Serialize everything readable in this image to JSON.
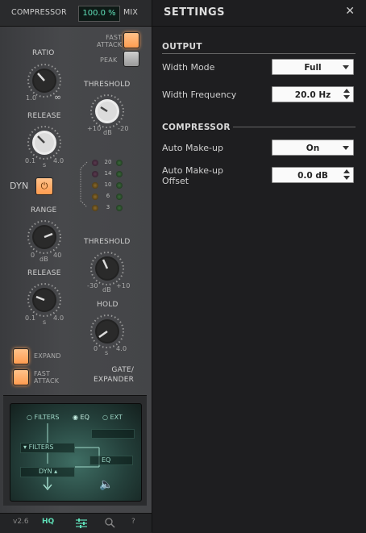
{
  "plugin": {
    "header": {
      "compressor_label": "COMPRESSOR",
      "mix_value": "100.0 %",
      "mix_label": "MIX"
    },
    "compressor": {
      "fast_attack_label": "FAST\nATTACK",
      "peak_label": "PEAK",
      "ratio": {
        "label": "RATIO",
        "min": "1.0",
        "max": "∞"
      },
      "threshold": {
        "label": "THRESHOLD",
        "min": "+10",
        "unit": "dB",
        "max": "-20"
      },
      "release": {
        "label": "RELEASE",
        "min": "0.1",
        "unit": "s",
        "max": "4.0"
      }
    },
    "meter": {
      "levels": [
        "20",
        "14",
        "10",
        "6",
        "3"
      ]
    },
    "dyn_label": "DYN",
    "gate": {
      "range": {
        "label": "RANGE",
        "min": "0",
        "unit": "dB",
        "max": "40"
      },
      "threshold": {
        "label": "THRESHOLD",
        "min": "-30",
        "unit": "dB",
        "max": "+10"
      },
      "release": {
        "label": "RELEASE",
        "min": "0.1",
        "unit": "s",
        "max": "4.0"
      },
      "hold": {
        "label": "HOLD",
        "min": "0",
        "unit": "s",
        "max": "4.0"
      },
      "expand_label": "EXPAND",
      "fast_attack_label": "FAST\nATTACK",
      "title": "GATE/\nEXPANDER"
    },
    "routing": {
      "filters_radio": "FILTERS",
      "eq_radio": "EQ",
      "ext_radio": "EXT",
      "filters_block": "FILTERS",
      "eq_block": "EQ",
      "dyn_block": "DYN"
    },
    "footer": {
      "version": "v2.6",
      "hq_label": "HQ"
    }
  },
  "settings": {
    "title": "SETTINGS",
    "close_icon": "close-icon",
    "output": {
      "section_title": "OUTPUT",
      "width_mode_label": "Width Mode",
      "width_mode_value": "Full",
      "width_frequency_label": "Width Frequency",
      "width_frequency_value": "20.0 Hz"
    },
    "compressor": {
      "section_title": "COMPRESSOR",
      "auto_makeup_label": "Auto Make-up",
      "auto_makeup_value": "On",
      "auto_makeup_offset_label": "Auto Make-up\nOffset",
      "auto_makeup_offset_value": "0.0 dB"
    }
  }
}
